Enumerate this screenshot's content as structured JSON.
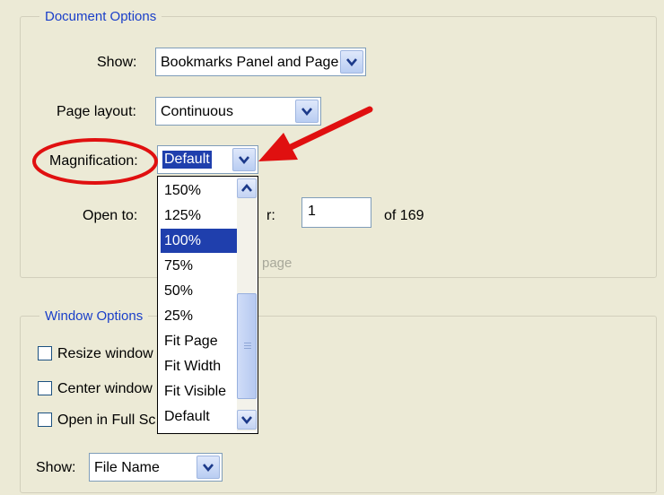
{
  "document_options": {
    "legend": "Document Options",
    "show_label": "Show:",
    "show_value": "Bookmarks Panel and Page",
    "page_layout_label": "Page layout:",
    "page_layout_value": "Continuous",
    "magnification_label": "Magnification:",
    "magnification_value": "Default",
    "open_to_label": "Open to:",
    "page_label_partial": "r:",
    "page_number_value": "1",
    "page_total": "of 169",
    "page_hint_partial": "page"
  },
  "magnification_dropdown": {
    "options": [
      "150%",
      "125%",
      "100%",
      "75%",
      "50%",
      "25%",
      "Fit Page",
      "Fit Width",
      "Fit Visible",
      "Default"
    ],
    "selected": "100%"
  },
  "window_options": {
    "legend": "Window Options",
    "resize_window_label": "Resize window",
    "center_window_label": "Center window",
    "full_screen_label": "Open in Full Sc",
    "show_label": "Show:",
    "show_value": "File Name"
  },
  "annotation": {
    "circle_color": "#e01010",
    "arrow_color": "#e01010"
  }
}
